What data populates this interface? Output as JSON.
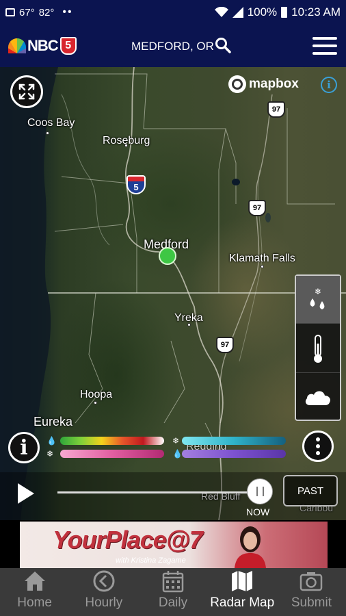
{
  "status_bar": {
    "temp_1": "67°",
    "temp_2": "82°",
    "more": "••",
    "battery": "100%",
    "time": "10:23 AM"
  },
  "header": {
    "logo_text": "NBC",
    "logo_channel": "5",
    "location": "MEDFORD, OR"
  },
  "map": {
    "attribution": "mapbox",
    "labels": {
      "coos_bay": "Coos Bay",
      "roseburg": "Roseburg",
      "medford": "Medford",
      "klamath_falls": "Klamath Falls",
      "yreka": "Yreka",
      "hoopa": "Hoopa",
      "eureka": "Eureka",
      "redding": "Redding",
      "red_bluff": "Red Bluff",
      "caribou": "Caribou"
    },
    "shields": {
      "i5": "5",
      "us97_a": "97",
      "us97_b": "97",
      "us97_c": "97"
    },
    "colors": {
      "location_dot": "#3ec744"
    }
  },
  "legend": {
    "rain_colors": [
      "#2fa53a",
      "#7fd13a",
      "#f3d21c",
      "#e7562a",
      "#c0191f",
      "#ffffff"
    ],
    "snow_colors": [
      "#7fe6f0",
      "#2fb3c9",
      "#15607e"
    ],
    "mix_colors": [
      "#f7a8d0",
      "#e25fa1",
      "#b32a73"
    ],
    "ice_colors": [
      "#a37fe0",
      "#7d52cf",
      "#5a35a8"
    ]
  },
  "timeline": {
    "now_label": "NOW",
    "past_label": "PAST"
  },
  "ad": {
    "title": "YourPlace@7",
    "subtitle": "with Kristina Zagame"
  },
  "nav": {
    "items": [
      {
        "label": "Home",
        "icon": "home-icon"
      },
      {
        "label": "Hourly",
        "icon": "clock-icon"
      },
      {
        "label": "Daily",
        "icon": "calendar-icon"
      },
      {
        "label": "Radar Map",
        "icon": "map-icon"
      },
      {
        "label": "Submit",
        "icon": "camera-icon"
      }
    ],
    "active": "Radar Map"
  }
}
